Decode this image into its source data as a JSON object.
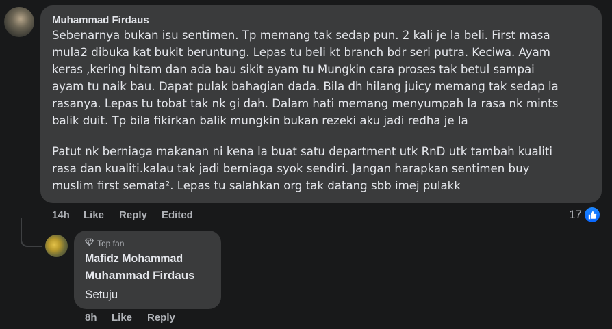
{
  "comment": {
    "author": "Muhammad Firdaus",
    "paragraph1": "Sebenarnya bukan isu sentimen. Tp memang tak sedap pun. 2 kali je la beli. First masa\nmula2 dibuka kat bukit beruntung. Lepas tu beli kt branch bdr seri putra. Keciwa. Ayam\nkeras ,kering hitam dan ada bau sikit ayam tu Mungkin cara proses tak betul sampai\nayam tu naik bau. Dapat pulak bahagian dada. Bila dh hilang juicy memang tak sedap la\nrasanya. Lepas tu tobat tak nk gi dah. Dalam hati memang menyumpah la rasa nk mints\nbalik duit. Tp bila fikirkan balik mungkin bukan rezeki aku jadi redha je la",
    "paragraph2": "Patut nk berniaga makanan ni kena la buat satu department utk RnD utk tambah kualiti\nrasa dan kualiti.kalau tak jadi berniaga syok sendiri. Jangan harapkan sentimen buy\nmuslim first semata². Lepas tu salahkan org tak datang sbb imej pulakk",
    "time": "14h",
    "like_label": "Like",
    "reply_label": "Reply",
    "edited_label": "Edited",
    "reaction_count": "17",
    "reaction_icon": "like-icon"
  },
  "reply": {
    "badge": "Top fan",
    "badge_icon": "diamond-icon",
    "author": "Mafidz Mohammad",
    "mention": "Muhammad Firdaus",
    "text": "Setuju",
    "time": "8h",
    "like_label": "Like",
    "reply_label": "Reply"
  },
  "colors": {
    "background": "#18191a",
    "bubble": "#3a3b3c",
    "text_primary": "#e4e6eb",
    "text_secondary": "#b0b3b8",
    "like_blue": "#0866ff"
  }
}
